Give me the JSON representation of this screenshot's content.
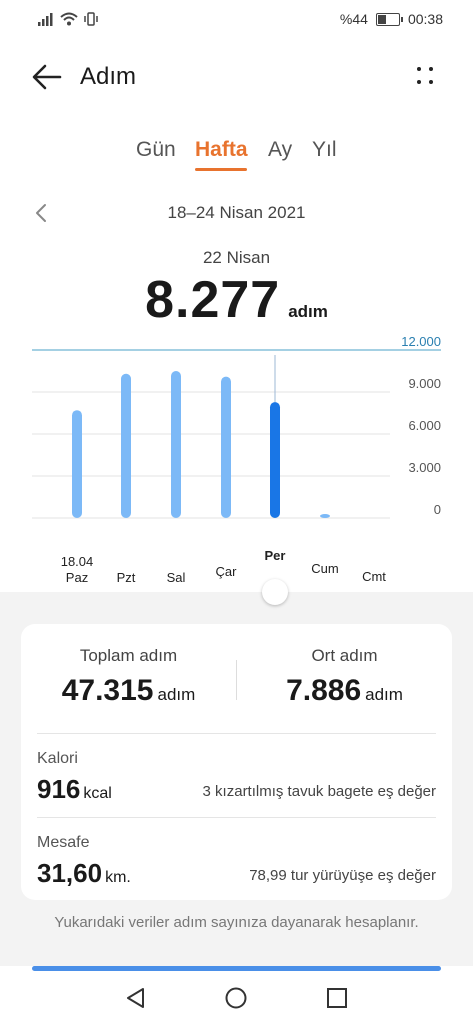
{
  "status": {
    "battery_text": "%44",
    "time": "00:38",
    "battery_level": 0.44
  },
  "header": {
    "title": "Adım"
  },
  "tabs": [
    {
      "label": "Gün",
      "active": false
    },
    {
      "label": "Hafta",
      "active": true
    },
    {
      "label": "Ay",
      "active": false
    },
    {
      "label": "Yıl",
      "active": false
    }
  ],
  "range": {
    "label": "18–24 Nisan 2021"
  },
  "selected": {
    "date": "22 Nisan",
    "value": "8.277",
    "unit": "adım"
  },
  "chart_data": {
    "type": "bar",
    "categories": [
      "Paz",
      "Pzt",
      "Sal",
      "Çar",
      "Per",
      "Cum",
      "Cmt"
    ],
    "first_date": "18.04",
    "values": [
      7700,
      10300,
      10500,
      10100,
      8277,
      250,
      0
    ],
    "selected_index": 4,
    "ylim": [
      0,
      12000
    ],
    "yticks": [
      0,
      3000,
      6000,
      9000,
      12000
    ],
    "ytick_labels": [
      "0",
      "3.000",
      "6.000",
      "9.000",
      "12.000"
    ],
    "colors": {
      "bar": "#7cb9f7",
      "selected": "#1976e6",
      "goal": "#4aa0c7"
    }
  },
  "summary": {
    "total_label": "Toplam adım",
    "total_value": "47.315",
    "total_unit": "adım",
    "avg_label": "Ort adım",
    "avg_value": "7.886",
    "avg_unit": "adım"
  },
  "calories": {
    "label": "Kalori",
    "value": "916",
    "unit": "kcal",
    "equiv": "3 kızartılmış tavuk bagete eş değer"
  },
  "distance": {
    "label": "Mesafe",
    "value": "31,60",
    "unit": "km.",
    "equiv": "78,99 tur yürüyüşe eş değer"
  },
  "note": "Yukarıdaki veriler adım sayınıza dayanarak hesaplanır.",
  "icons": [
    "signal-icon",
    "wifi-icon",
    "vibrate-icon",
    "battery-icon",
    "back-arrow-icon",
    "more-icon",
    "chevron-left-icon",
    "nav-back-icon",
    "nav-home-icon",
    "nav-recents-icon"
  ],
  "accent": "#e8732e",
  "scroll_progress": 1.0
}
